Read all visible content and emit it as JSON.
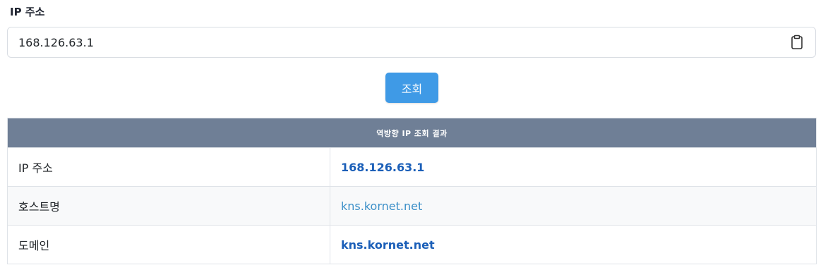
{
  "form": {
    "label": "IP 주소",
    "ip_value": "168.126.63.1",
    "clipboard_icon": "clipboard-icon"
  },
  "actions": {
    "lookup_label": "조회",
    "accent_color": "#3f9ae6"
  },
  "result": {
    "header": "역방향 IP 조회 결과",
    "header_bg": "#6f7f96",
    "rows": [
      {
        "key": "IP 주소",
        "value": "168.126.63.1"
      },
      {
        "key": "호스트명",
        "value": "kns.kornet.net"
      },
      {
        "key": "도메인",
        "value": "kns.kornet.net"
      }
    ]
  }
}
